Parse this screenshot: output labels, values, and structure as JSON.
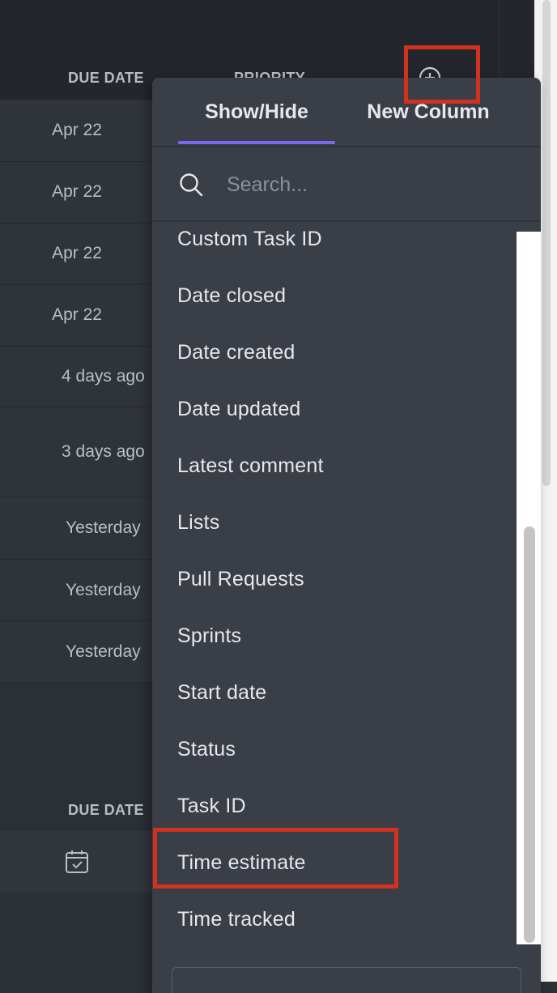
{
  "table": {
    "headers": {
      "due_date": "DUE DATE",
      "priority": "PRIORITY"
    },
    "due_dates": [
      "Apr 22",
      "Apr 22",
      "Apr 22",
      "Apr 22",
      "4 days ago",
      "3 days ago",
      "Yesterday",
      "Yesterday",
      "Yesterday"
    ],
    "section2_header": "DUE DATE"
  },
  "icons": {
    "add_column": "plus-circle-icon",
    "search": "search-icon",
    "calendar": "calendar-check-icon"
  },
  "popup": {
    "tabs": [
      {
        "label": "Show/Hide",
        "active": true
      },
      {
        "label": "New Column",
        "active": false
      }
    ],
    "search": {
      "placeholder": "Search..."
    },
    "items": [
      "Custom Task ID",
      "Date closed",
      "Date created",
      "Date updated",
      "Latest comment",
      "Lists",
      "Pull Requests",
      "Sprints",
      "Start date",
      "Status",
      "Task ID",
      "Time estimate",
      "Time tracked"
    ]
  },
  "colors": {
    "accent": "#7b68ee",
    "highlight": "#d0321f",
    "popup_bg": "#3a3e46"
  }
}
